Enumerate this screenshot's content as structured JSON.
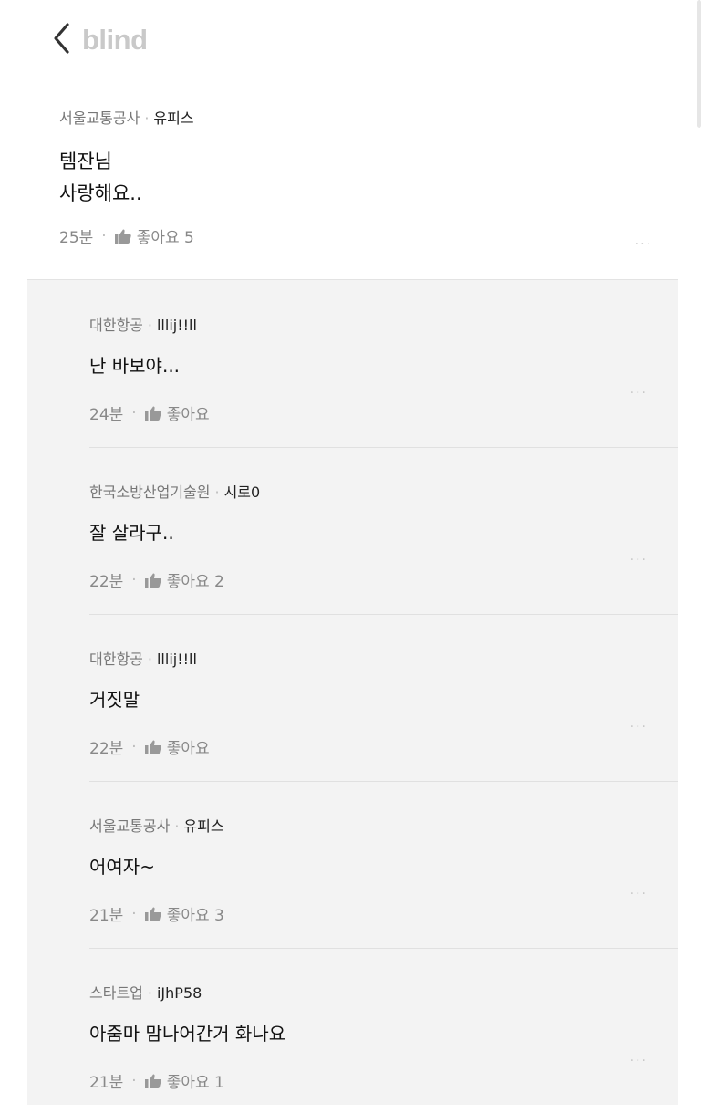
{
  "header": {
    "logo": "blind"
  },
  "post": {
    "company": "서울교통공사",
    "nickname": "유피스",
    "lines": [
      "템잔님",
      "사랑해요.."
    ],
    "time": "25분",
    "like_label": "좋아요 5",
    "more": "..."
  },
  "comments": [
    {
      "company": "대한항공",
      "nickname": "lllij!!ll",
      "text": "난 바보야...",
      "time": "24분",
      "like_label": "좋아요",
      "more": "..."
    },
    {
      "company": "한국소방산업기술원",
      "nickname": "시로0",
      "text": "잘 살라구..",
      "time": "22분",
      "like_label": "좋아요 2",
      "more": "..."
    },
    {
      "company": "대한항공",
      "nickname": "lllij!!ll",
      "text": "거짓말",
      "time": "22분",
      "like_label": "좋아요",
      "more": "..."
    },
    {
      "company": "서울교통공사",
      "nickname": "유피스",
      "text": "어여자~",
      "time": "21분",
      "like_label": "좋아요 3",
      "more": "..."
    },
    {
      "company": "스타트업",
      "nickname": "iJhP58",
      "text": "아줌마 맘나어간거 화나요",
      "time": "21분",
      "like_label": "좋아요 1",
      "more": "..."
    }
  ],
  "colors": {
    "logo": "#c9c9c9",
    "comment_bg": "#f3f3f3",
    "meta": "#777777"
  },
  "icons": {
    "back": "chevron-left-icon",
    "like": "thumbs-up-icon"
  }
}
